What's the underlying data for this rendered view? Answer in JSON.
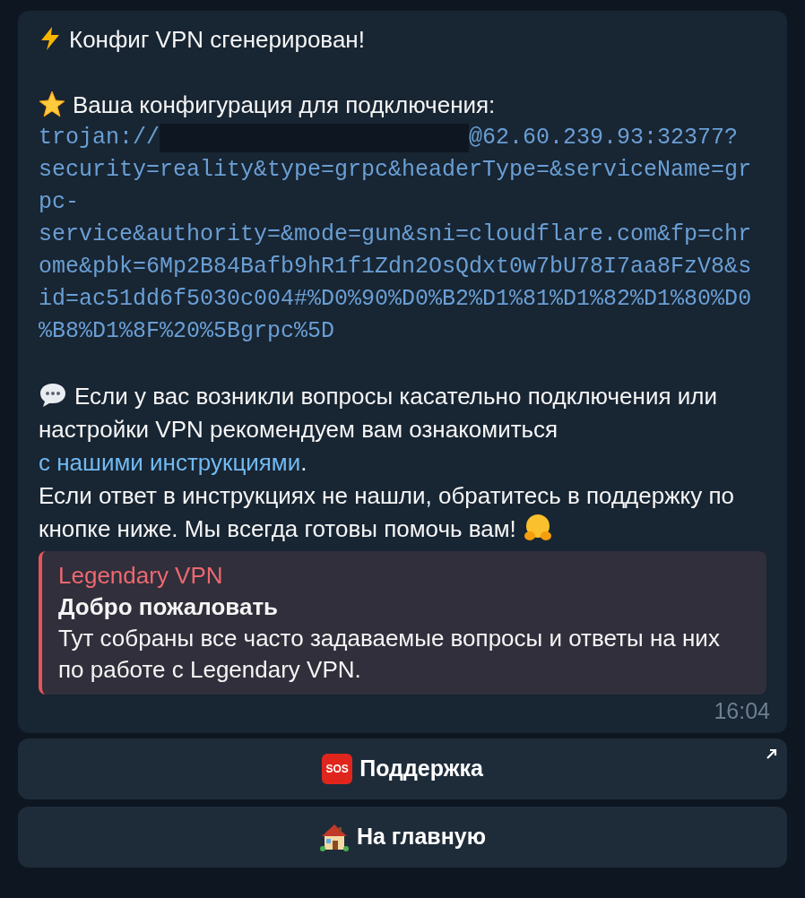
{
  "message": {
    "title": "Конфиг VPN сгенерирован!",
    "config_label": "Ваша конфигурация для подключения:",
    "config": {
      "prefix": "trojan://",
      "redacted": true,
      "host": "@62.60.239.93:32377?",
      "lines": [
        "security=reality&type=grpc&headerType=&serviceName=gr",
        "pc-",
        "service&authority=&mode=gun&sni=cloudflare.com&fp=chr",
        "ome&pbk=6Mp2B84Bafb9hR1f1Zdn2OsQdxt0w7bU78I7aa8FzV8&s",
        "id=ac51dd6f5030c004#%D0%90%D0%B2%D1%81%D1%82%D1%80%D0",
        "%B8%D1%8F%20%5Bgrpc%5D"
      ]
    },
    "help_text": "Если у вас возникли вопросы касательно подключения или настройки VPN рекомендуем вам ознакомиться",
    "help_link": "с нашими инструкциями",
    "help_end": ".",
    "support_text": "Если ответ в инструкциях не нашли, обратитесь в поддержку по кнопке ниже. Мы всегда готовы помочь вам!",
    "preview": {
      "site": "Legendary VPN",
      "title": "Добро пожаловать",
      "description": "Тут собраны все часто задаваемые вопросы и ответы на них по работе с Legendary VPN."
    },
    "time": "16:04"
  },
  "buttons": [
    {
      "kind": "sos",
      "badge": "SOS",
      "label": "Поддержка",
      "external": true
    },
    {
      "kind": "home",
      "label": "На главную",
      "external": false
    }
  ]
}
